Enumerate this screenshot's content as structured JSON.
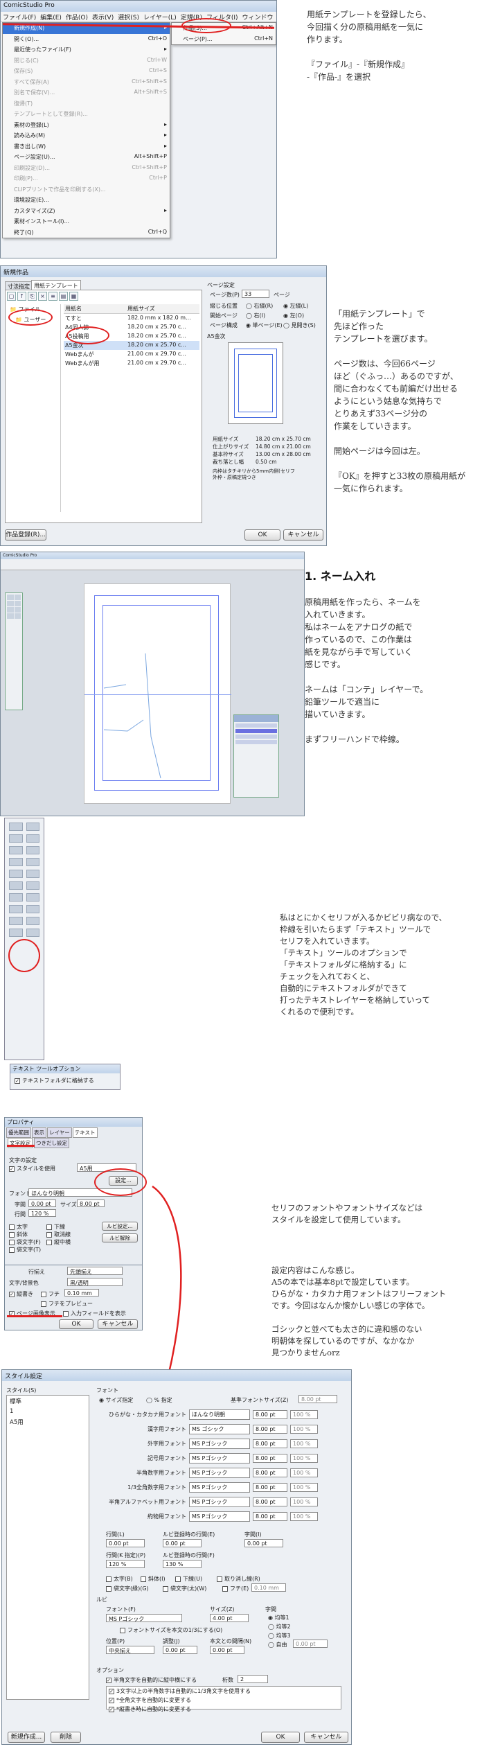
{
  "app_title": "ComicStudio Pro",
  "menubar": [
    "ファイル(F)",
    "編集(E)",
    "作品(O)",
    "表示(V)",
    "選択(S)",
    "レイヤー(L)",
    "定規(R)",
    "フィルタ(I)",
    "ウィンドウ"
  ],
  "file_menu": [
    {
      "label": "新規作成(N)",
      "shortcut": "▸",
      "state": "hl"
    },
    {
      "label": "開く(O)...",
      "shortcut": "Ctrl+O",
      "state": ""
    },
    {
      "label": "最近使ったファイル(F)",
      "shortcut": "▸",
      "state": ""
    },
    {
      "label": "閉じる(C)",
      "shortcut": "Ctrl+W",
      "state": "dis"
    },
    {
      "label": "保存(S)",
      "shortcut": "Ctrl+S",
      "state": "dis"
    },
    {
      "label": "すべて保存(A)",
      "shortcut": "Ctrl+Shift+S",
      "state": "dis"
    },
    {
      "label": "別名で保存(V)...",
      "shortcut": "Alt+Shift+S",
      "state": "dis"
    },
    {
      "label": "復帰(T)",
      "shortcut": "",
      "state": "dis"
    },
    {
      "label": "テンプレートとして登録(R)...",
      "shortcut": "",
      "state": "dis"
    },
    {
      "label": "素材の登録(L)",
      "shortcut": "▸",
      "state": ""
    },
    {
      "label": "読み込み(M)",
      "shortcut": "▸",
      "state": ""
    },
    {
      "label": "書き出し(W)",
      "shortcut": "▸",
      "state": ""
    },
    {
      "label": "ページ設定(U)...",
      "shortcut": "Alt+Shift+P",
      "state": ""
    },
    {
      "label": "印刷設定(D)...",
      "shortcut": "Ctrl+Shift+P",
      "state": "dis"
    },
    {
      "label": "印刷(P)...",
      "shortcut": "Ctrl+P",
      "state": "dis"
    },
    {
      "label": "CLIPプリントで作品を印刷する(X)...",
      "shortcut": "",
      "state": "dis"
    },
    {
      "label": "環境設定(E)...",
      "shortcut": "",
      "state": ""
    },
    {
      "label": "カスタマイズ(Z)",
      "shortcut": "▸",
      "state": ""
    },
    {
      "label": "素材インストール(I)...",
      "shortcut": "",
      "state": ""
    },
    {
      "label": "終了(Q)",
      "shortcut": "Ctrl+Q",
      "state": ""
    }
  ],
  "submenu": [
    {
      "label": "作品(S)...",
      "shortcut": "Ctrl+Alt+N"
    },
    {
      "label": "ページ(P)...",
      "shortcut": "Ctrl+N"
    }
  ],
  "note1": "用紙テンプレートを登録したら、\n今回描く分の原稿用紙を一気に\n作ります。\n\n『ファイル』-『新規作成』\n-『作品-』を選択",
  "dlg1": {
    "title": "新規作品",
    "tabs": [
      "寸法指定",
      "用紙テンプレート"
    ],
    "tree": [
      "ファイル",
      "ユーザー"
    ],
    "list_headers": [
      "用紙名",
      "用紙サイズ"
    ],
    "rows": [
      {
        "name": "てすと",
        "size": "182.0 mm x 182.0 m..."
      },
      {
        "name": "A4同人誌",
        "size": "18.20 cm x 25.70 c..."
      },
      {
        "name": "A5投稿用",
        "size": "18.20 cm x 25.70 c..."
      },
      {
        "name": "A5金次",
        "size": "18.20 cm x 25.70 c..."
      },
      {
        "name": "Webまんが",
        "size": "21.00 cm x 29.70 c..."
      },
      {
        "name": "Webまんが用",
        "size": "21.00 cm x 29.70 c..."
      }
    ],
    "page_group": "ページ設定",
    "page_count_label": "ページ数(P)",
    "page_count": "33",
    "page_unit": "ページ",
    "bind_label": "綴じる位置",
    "bind_opts": [
      "右綴(R)",
      "左綴(L)"
    ],
    "start_label": "開始ページ",
    "start_opts": [
      "右(I)",
      "左(O)"
    ],
    "layout_label": "ページ構成",
    "layout_opts": [
      "単ページ(E)",
      "見開き(S)"
    ],
    "preview_title": "A5金次",
    "info": [
      [
        "用紙サイズ",
        "18.20 cm x 25.70 cm"
      ],
      [
        "仕上がりサイズ",
        "14.80 cm x 21.00 cm"
      ],
      [
        "基本枠サイズ",
        "13.00 cm x 28.00 cm"
      ],
      [
        "裁ち落とし幅",
        "0.50 cm"
      ]
    ],
    "info_note": "内枠はタチキリから5mm内側(セリフ\n外枠・原稿定規つき",
    "btn_reg": "作品登録(R)...",
    "btn_ok": "OK",
    "btn_cancel": "キャンセル"
  },
  "note2": "「用紙テンプレート」で\n先ほど作った\nテンプレートを選びます。\n\nページ数は、今回66ページ\nほど（ぐふっ…）あるのですが、\n間に合わなくても前編だけ出せる\nようにという姑息な気持ちで\nとりあえず33ページ分の\n作業をしていきます。\n\n開始ページは今回は左。\n\n『OK』を押すと33枚の原稿用紙が\n一気に作られます。",
  "section_title": "1. ネーム入れ",
  "note3": "原稿用紙を作ったら、ネームを\n入れていきます。\n私はネームをアナログの紙で\n作っているので、この作業は\n紙を見ながら手で写していく\n感じです。\n\nネームは「コンテ」レイヤーで。\n鉛筆ツールで適当に\n描いていきます。\n\nまずフリーハンドで枠線。",
  "note4": "私はとにかくセリフが入るかビビリ病なので、\n枠線を引いたらまず「テキスト」ツールで\nセリフを入れていきます。\n「テキスト」ツールのオプションで\n「テキストフォルダに格納する」に\nチェックを入れておくと、\n自動的にテキストフォルダができて\n打ったテキストレイヤーを格納していって\nくれるので便利です。",
  "tool_option": {
    "title": "テキスト ツールオプション",
    "checkbox": "テキストフォルダに格納する"
  },
  "prop": {
    "title": "プロパティ",
    "tabs": [
      "優先範囲",
      "表示",
      "レイヤー",
      "テキスト"
    ],
    "subtabs": [
      "文字設定",
      "つきだし設定"
    ],
    "group": "文字の設定",
    "style_chk": "スタイルを使用",
    "style_val": "A5用",
    "settings_btn": "設定...",
    "font_lbl": "フォント",
    "font_val": "ほんなり明朝",
    "size_lbl": "字間",
    "size_val": "0.00 pt",
    "size2_lbl": "サイズ",
    "size2_val": "8.00 pt",
    "lead_lbl": "行間",
    "lead_val": "120 %",
    "bold": "太字",
    "checks": [
      "太字",
      "斜体",
      "袋文字(F)",
      "袋文字(T)"
    ],
    "checks2": [
      "下線",
      "取消線",
      "縦中横"
    ],
    "ruby_btn": "ルビ設定...",
    "ruby_btn2": "ルビ解除",
    "align_lbl": "行揃え",
    "align_val": "先頭揃え",
    "color_lbl": "文字/背景色",
    "color_val": "黒/透明",
    "vertical": "縦書き",
    "fuchi": "フチ",
    "fuchi_val": "0.10 mm",
    "fuchi_chk": "フチをプレビュー",
    "page_chk": "ページ画像表示",
    "input_chk": "入力フィールドを表示",
    "ok": "OK",
    "cancel": "キャンセル"
  },
  "note5": "セリフのフォントやフォントサイズなどは\nスタイルを設定して使用しています。",
  "note6": "設定内容はこんな感じ。\nA5の本では基本8ptで設定しています。\nひらがな・カタカナ用フォントはフリーフォント\nです。今回はなんか懐かしい感じの字体で。\n\nゴシックと並べても太さ的に違和感のない\n明朝体を探しているのですが、なかなか\n見つかりませんorz",
  "style_dlg": {
    "title": "スタイル設定",
    "style_lbl": "スタイル(S)",
    "styles": [
      "標準",
      "1",
      "A5用"
    ],
    "font_group": "フォント",
    "radio": [
      "サイズ指定",
      "% 指定"
    ],
    "base_lbl": "基準フォントサイズ(Z)",
    "base_val": "8.00 pt",
    "fonts": [
      [
        "ひらがな・カタカナ用フォント",
        "ほんなり明朝",
        "8.00 pt",
        "100 %"
      ],
      [
        "漢字用フォント",
        "MS ゴシック",
        "8.00 pt",
        "100 %"
      ],
      [
        "外字用フォント",
        "MS Pゴシック",
        "8.00 pt",
        "100 %"
      ],
      [
        "記号用フォント",
        "MS Pゴシック",
        "8.00 pt",
        "100 %"
      ],
      [
        "半角数字用フォント",
        "MS Pゴシック",
        "8.00 pt",
        "100 %"
      ],
      [
        "1/3全角数字用フォント",
        "MS Pゴシック",
        "8.00 pt",
        "100 %"
      ],
      [
        "半角アルファベット用フォント",
        "MS Pゴシック",
        "8.00 pt",
        "100 %"
      ],
      [
        "約物用フォント",
        "MS Pゴシック",
        "8.00 pt",
        "100 %"
      ]
    ],
    "gap_lbl": "行間(L)",
    "gap_val": "0.00 pt",
    "ruby_gap_lbl": "ルビ登録時の行間(E)",
    "ruby_gap_val": "0.00 pt",
    "char_gap_lbl": "字間(I)",
    "char_gap_val": "0.00 pt",
    "lead_lbl": "行間(K 指定)(P)",
    "lead_val": "120 %",
    "ruby_lead_lbl": "ルビ登録時の行間(F)",
    "ruby_lead_val": "130 %",
    "checks": [
      "太字(B)",
      "斜体(I)",
      "下線(U)",
      "取り消し線(R)",
      "袋文字(縁)(G)",
      "袋文字(太)(W)",
      "フチ(E)"
    ],
    "fuchi_val": "0.10 mm",
    "ruby_group": "ルビ",
    "ruby_font_lbl": "フォント(F)",
    "ruby_font_val": "MS Pゴシック",
    "ruby_size_lbl": "サイズ(Z)",
    "ruby_size_val": "4.00 pt",
    "ruby_chk": "フォントサイズを本文の1/3にする(O)",
    "pos_lbl": "位置(P)",
    "pos_val": "中央揃え",
    "adj_lbl": "調整(J)",
    "adj_val": "0.00 pt",
    "dist_lbl": "本文との間隔(N)",
    "dist_val": "0.00 pt",
    "kern_lbl": "字間",
    "kern_opts": [
      "均等1",
      "均等2",
      "均等3",
      "自由"
    ],
    "kern_val": "0.00 pt",
    "opt_group": "オプション",
    "opt1": "半角文字を自動的に縦中横にする",
    "opt1_num_lbl": "桁数",
    "opt1_num": "2",
    "opts": [
      "3文字以上の半角数字は自動的に1/3角文字を使用する",
      "*全角文字を自動的に変更する",
      "*縦書き時に自動的に変更する"
    ],
    "btn_new": "新規作成...",
    "btn_del": "削除",
    "btn_ok": "OK",
    "btn_cancel": "キャンセル"
  }
}
